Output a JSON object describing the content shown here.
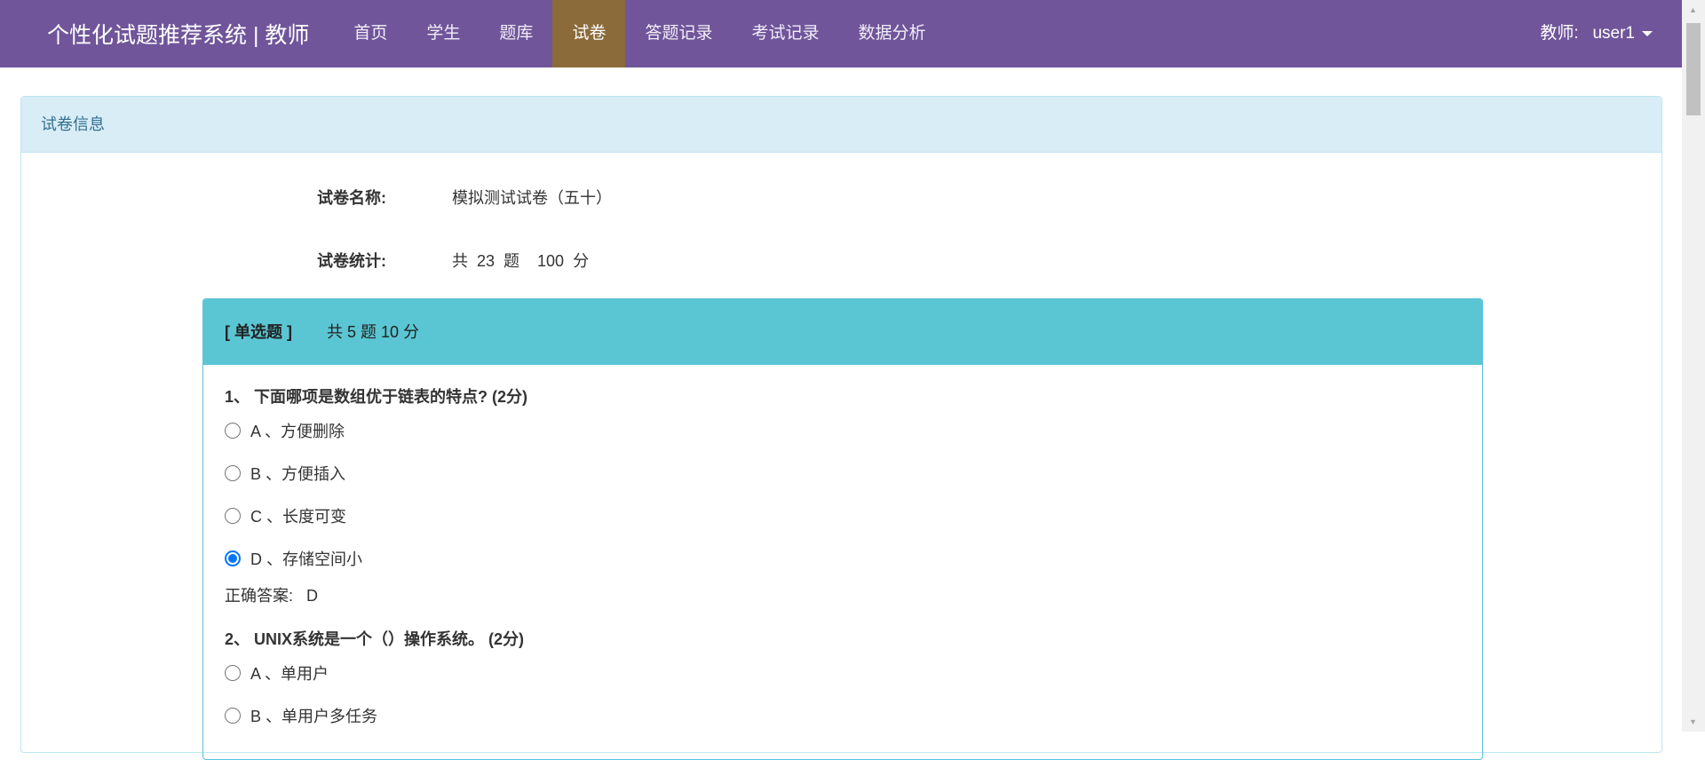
{
  "navbar": {
    "brand": "个性化试题推荐系统 | 教师",
    "items": [
      {
        "label": "首页"
      },
      {
        "label": "学生"
      },
      {
        "label": "题库"
      },
      {
        "label": "试卷",
        "active": true
      },
      {
        "label": "答题记录"
      },
      {
        "label": "考试记录"
      },
      {
        "label": "数据分析"
      }
    ],
    "user": "教师:   user1"
  },
  "panel": {
    "title": "试卷信息",
    "name_label": "试卷名称:",
    "name_value": "模拟测试试卷（五十）",
    "stats_label": "试卷统计:",
    "stats_value": "共  23  题    100  分"
  },
  "section": {
    "type": "[ 单选题 ]",
    "summary": "共 5 题  10 分"
  },
  "questions": [
    {
      "title": "1、  下面哪项是数组优于链表的特点? (2分)",
      "options": [
        "A 、方便删除",
        "B 、方便插入",
        "C 、长度可变",
        "D 、存储空间小"
      ],
      "selected": 3,
      "answer": "正确答案:   D"
    },
    {
      "title": "2、  UNIX系统是一个（）操作系统。 (2分)",
      "options": [
        "A 、单用户",
        "B 、单用户多任务"
      ]
    }
  ],
  "colors": {
    "navbar": "#70559a",
    "active": "#8b6b3a",
    "section": "#5bc6d3",
    "panel_head": "#d9edf7"
  }
}
